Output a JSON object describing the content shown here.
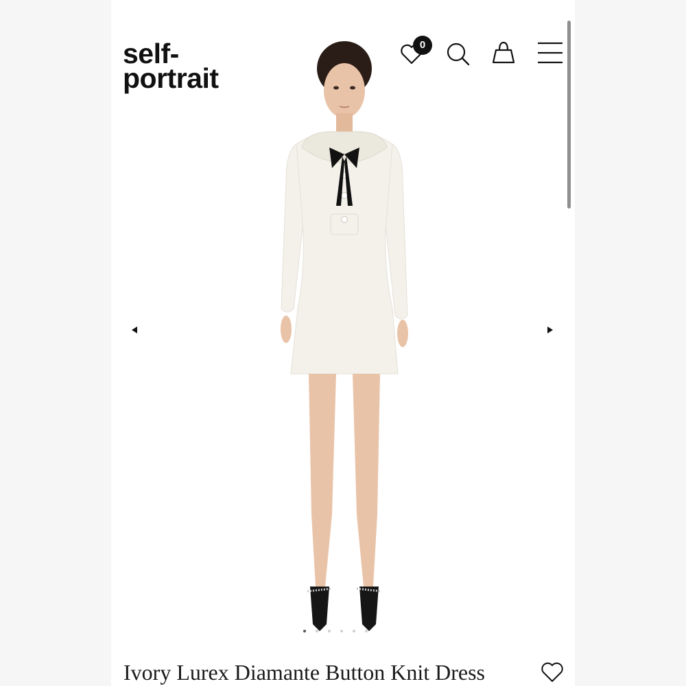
{
  "brand": {
    "logo_line1": "self-",
    "logo_line2": "portrait"
  },
  "header": {
    "wishlist_count": "0",
    "icons": [
      "heart-icon",
      "search-icon",
      "bag-icon",
      "menu-icon"
    ]
  },
  "gallery": {
    "image_subject": "model wearing ivory knit mini dress with black bow",
    "slide_count": 6,
    "active_slide": 1
  },
  "product": {
    "title": "Ivory Lurex Diamante Button Knit Dress"
  },
  "colors": {
    "dress": "#f3f1ea",
    "bow": "#111111",
    "skin": "#e9c3a8",
    "hair": "#2a1c16"
  }
}
